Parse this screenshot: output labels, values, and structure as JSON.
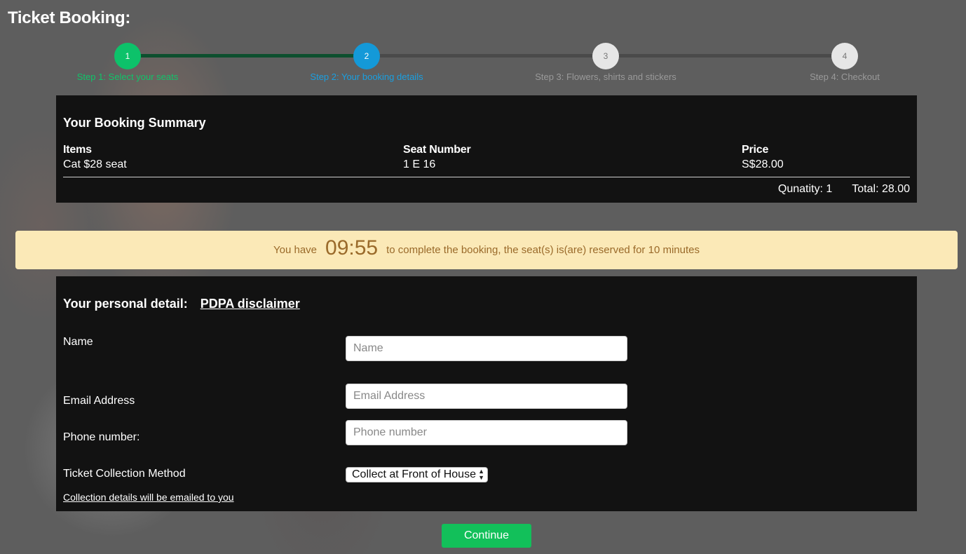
{
  "page": {
    "title": "Ticket Booking:"
  },
  "stepper": {
    "steps": [
      {
        "number": "1",
        "label": "Step 1: Select your seats",
        "status": "complete"
      },
      {
        "number": "2",
        "label": "Step 2: Your booking details",
        "status": "active"
      },
      {
        "number": "3",
        "label": "Step 3: Flowers, shirts and stickers",
        "status": "pending"
      },
      {
        "number": "4",
        "label": "Step 4: Checkout",
        "status": "pending"
      }
    ]
  },
  "summary": {
    "title": "Your Booking Summary",
    "columns": {
      "items": "Items",
      "seat": "Seat Number",
      "price": "Price"
    },
    "rows": [
      {
        "item": "Cat $28 seat",
        "seat": "1 E 16",
        "price": "S$28.00"
      }
    ],
    "quantity": "Qunatity: 1",
    "total": "Total: 28.00"
  },
  "timer": {
    "prefix": "You have",
    "countdown": "09:55",
    "suffix": "to complete the booking, the seat(s) is(are) reserved for 10 minutes"
  },
  "personal": {
    "title": "Your personal detail:",
    "disclaimer_link": "PDPA disclaimer",
    "name_label": "Name",
    "name_placeholder": "Name",
    "email_label": "Email Address",
    "email_placeholder": "Email Address",
    "phone_label": "Phone number:",
    "phone_placeholder": "Phone number",
    "collection_label": "Ticket Collection Method",
    "collection_selected": "Collect at Front of House",
    "collection_note": "Collection details will be emailed to you"
  },
  "actions": {
    "continue_label": "Continue"
  },
  "colors": {
    "step_complete": "#0dc26a",
    "step_active": "#1499d8",
    "step_pending": "#e6e6e6",
    "timer_bg": "#fbe9b7",
    "continue_bg": "#12c05a"
  }
}
